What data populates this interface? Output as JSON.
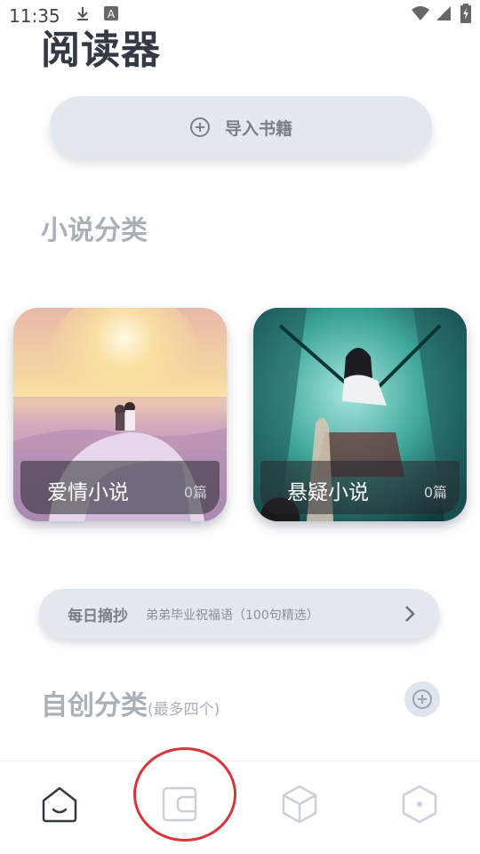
{
  "status_bar": {
    "time": "11:35",
    "icons": [
      "download-icon",
      "a-badge-icon",
      "wifi-icon",
      "signal-icon",
      "battery-icon"
    ]
  },
  "app": {
    "title": "阅读器"
  },
  "import": {
    "label": "导入书籍",
    "icon": "plus-circle-icon"
  },
  "novel_section": {
    "heading": "小说分类"
  },
  "categories": [
    {
      "title": "爱情小说",
      "count": "0篇",
      "art": "sunset-couple-illustration"
    },
    {
      "title": "悬疑小说",
      "count": "0篇",
      "art": "teal-falling-girl-illustration"
    }
  ],
  "daily": {
    "label": "每日摘抄",
    "text": "弟弟毕业祝福语（100句精选）",
    "icon": "chevron-right-icon"
  },
  "custom_section": {
    "heading": "自创分类",
    "note": "(最多四个)",
    "add_icon": "plus-circle-icon"
  },
  "bottom_nav": {
    "items": [
      {
        "name": "home",
        "icon": "home-smile-icon",
        "active": true
      },
      {
        "name": "bookshelf",
        "icon": "wallet-icon",
        "active": false
      },
      {
        "name": "discover",
        "icon": "cube-icon",
        "active": false
      },
      {
        "name": "profile",
        "icon": "hexagon-icon",
        "active": false
      }
    ]
  },
  "colors": {
    "title": "#333a45",
    "button_bg": "#e3e8ef",
    "muted_text": "#aab0b8",
    "annotation": "#d9353a"
  }
}
